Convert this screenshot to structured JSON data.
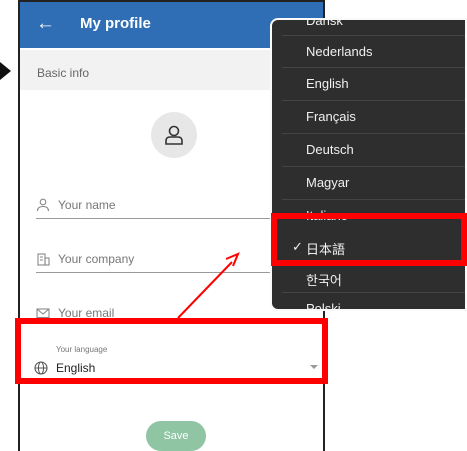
{
  "appbar": {
    "back_icon": "arrow-left-icon",
    "title": "My profile"
  },
  "section": {
    "title": "Basic info"
  },
  "avatar": {
    "icon": "person-icon"
  },
  "fields": {
    "name": {
      "icon": "person-outline-icon",
      "label": "Your name"
    },
    "company": {
      "icon": "building-icon",
      "label": "Your company"
    },
    "email": {
      "icon": "envelope-icon",
      "label": "Your email"
    }
  },
  "language": {
    "caption": "Your language",
    "value": "English",
    "icon": "globe-icon"
  },
  "save": {
    "label": "Save"
  },
  "dropdown": {
    "items": [
      {
        "label": "Dansk",
        "selected": false
      },
      {
        "label": "Nederlands",
        "selected": false
      },
      {
        "label": "English",
        "selected": false
      },
      {
        "label": "Français",
        "selected": false
      },
      {
        "label": "Deutsch",
        "selected": false
      },
      {
        "label": "Magyar",
        "selected": false
      },
      {
        "label": "Italiano",
        "selected": false
      },
      {
        "label": "日本語",
        "selected": true,
        "check": "✓"
      },
      {
        "label": "한국어",
        "selected": false
      },
      {
        "label": "Polski",
        "selected": false
      }
    ]
  },
  "colors": {
    "appbar": "#2f6db5",
    "save_button": "#8fc5a3",
    "highlight": "#ff0000",
    "dropdown_bg": "#2e2e2e"
  }
}
